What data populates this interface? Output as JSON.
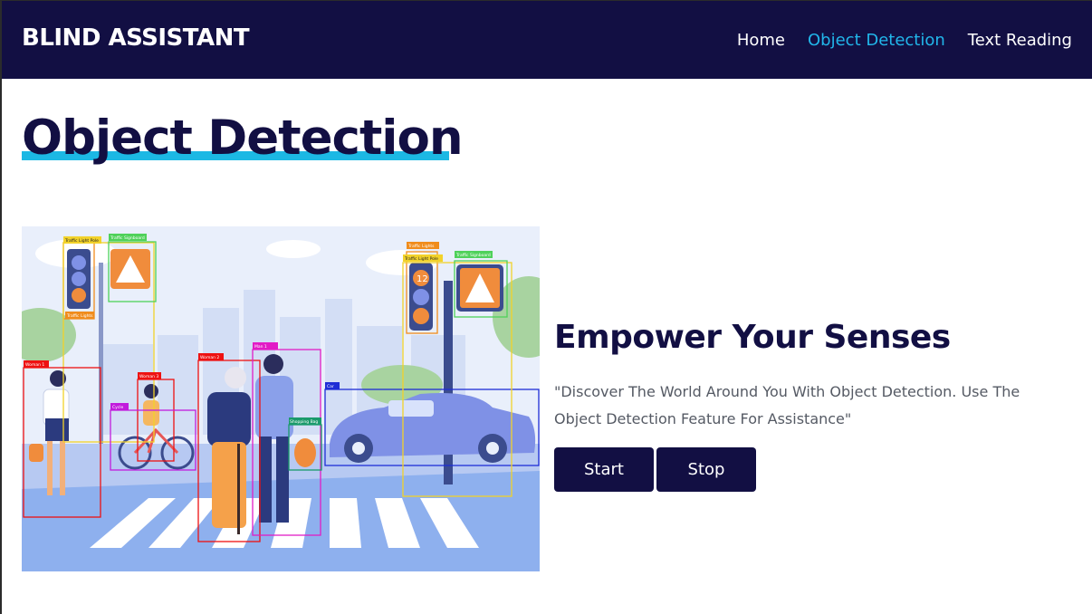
{
  "navbar": {
    "brand": "BLIND ASSISTANT",
    "links": [
      {
        "label": "Home",
        "active": false
      },
      {
        "label": "Object Detection",
        "active": true
      },
      {
        "label": "Text Reading",
        "active": false
      }
    ]
  },
  "main": {
    "title": "Object Detection",
    "tagline": "Empower Your Senses",
    "description": "\"Discover The World Around You With Object Detection. Use The Object Detection Feature For Assistance\"",
    "buttons": {
      "start": "Start",
      "stop": "Stop"
    }
  },
  "illustration": {
    "labels": {
      "traffic_light_pole_left": "Traffic Light Pole",
      "traffic_signboard_left": "Traffic Signboard",
      "traffic_lights_left": "Traffic Lights",
      "woman1": "Woman 1",
      "woman2": "Woman 2",
      "woman3": "Woman 3",
      "cycle": "Cycle",
      "man1": "Man 1",
      "shopping_bag": "Shopping Bag",
      "car": "Car",
      "traffic_lights_right": "Traffic Lights",
      "traffic_light_pole_right": "Traffic Light Pole",
      "traffic_signboard_right": "Traffic Signboard",
      "signal_number": "12"
    }
  },
  "colors": {
    "navbar_bg": "#120f43",
    "active_link": "#21b6ea",
    "underline": "#1cb8e4",
    "button_bg": "#120f43"
  }
}
